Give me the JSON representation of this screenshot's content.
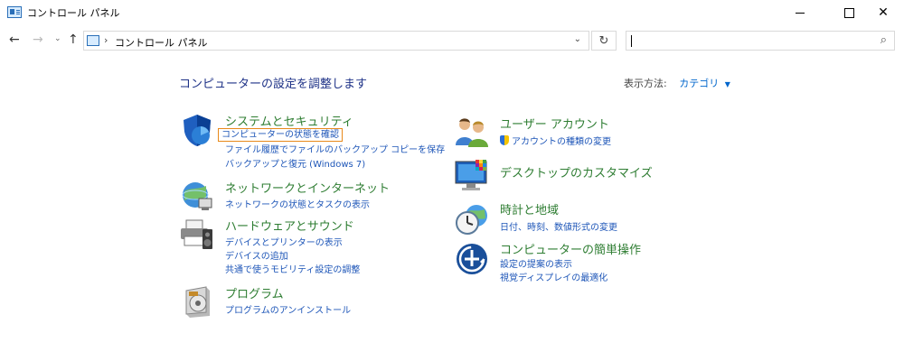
{
  "window": {
    "title": "コントロール パネル",
    "min_label": "",
    "max_label": "",
    "close_label": "✕"
  },
  "address_bar": {
    "back_label": "←",
    "forward_label": "→",
    "recent_label": "⌄",
    "up_label": "↑",
    "separator": "›",
    "breadcrumb": "コントロール パネル",
    "dropdown_label": "⌄",
    "refresh_label": "↻",
    "search_value": "",
    "search_icon": "⌕"
  },
  "main": {
    "heading": "コンピューターの設定を調整します",
    "view_by_label": "表示方法:",
    "view_by_value": "カテゴリ",
    "view_by_arrow": "▼"
  },
  "categories": [
    {
      "icon": "shield-icon",
      "title": "システムとセキュリティ",
      "links": [
        "コンピューターの状態を確認",
        "ファイル履歴でファイルのバックアップ コピーを保存",
        "バックアップと復元 (Windows 7)"
      ]
    },
    {
      "icon": "network-globe-icon",
      "title": "ネットワークとインターネット",
      "links": [
        "ネットワークの状態とタスクの表示"
      ]
    },
    {
      "icon": "printer-speaker-icon",
      "title": "ハードウェアとサウンド",
      "links": [
        "デバイスとプリンターの表示",
        "デバイスの追加",
        "共通で使うモビリティ設定の調整"
      ]
    },
    {
      "icon": "programs-icon",
      "title": "プログラム",
      "links": [
        "プログラムのアンインストール"
      ]
    },
    {
      "icon": "users-icon",
      "title": "ユーザー アカウント",
      "links": [
        "アカウントの種類の変更"
      ]
    },
    {
      "icon": "desktop-color-icon",
      "title": "デスクトップのカスタマイズ",
      "links": []
    },
    {
      "icon": "clock-globe-icon",
      "title": "時計と地域",
      "links": [
        "日付、時刻、数値形式の変更"
      ]
    },
    {
      "icon": "accessibility-icon",
      "title": "コンピューターの簡単操作",
      "links": [
        "設定の提案の表示",
        "視覚ディスプレイの最適化"
      ]
    }
  ],
  "colors": {
    "category_title": "#2e7d32",
    "link": "#1e56b8",
    "heading": "#1e3287",
    "focus_outline": "#e8891a"
  }
}
